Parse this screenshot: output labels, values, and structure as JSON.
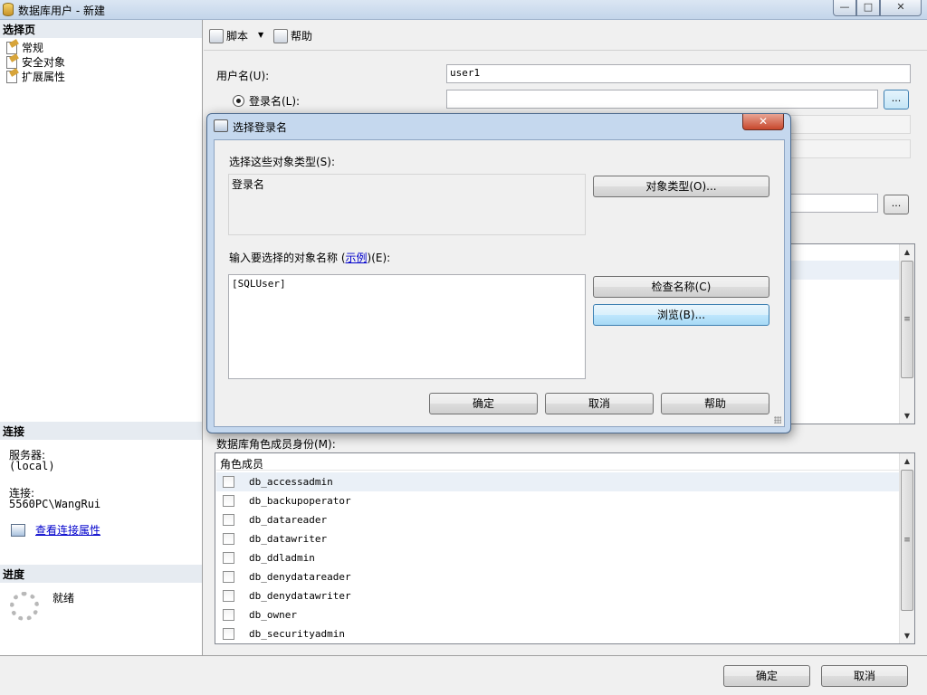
{
  "window": {
    "title": "数据库用户 - 新建",
    "minimize": "—",
    "maximize": "□",
    "close": "✕"
  },
  "left": {
    "select_page_header": "选择页",
    "pages": [
      "常规",
      "安全对象",
      "扩展属性"
    ],
    "connection_header": "连接",
    "server_label": "服务器:",
    "server_value": "(local)",
    "connection_label": "连接:",
    "connection_value": "5560PC\\WangRui",
    "view_conn_props": "查看连接属性",
    "progress_header": "进度",
    "progress_status": "就绪"
  },
  "toolbar": {
    "script": "脚本",
    "dropdown": "▼",
    "help": "帮助"
  },
  "form": {
    "username_label": "用户名(U):",
    "username_value": "user1",
    "login_label": "登录名(L):",
    "login_value": "",
    "browse_dots": "...",
    "role_membership_label": "数据库角色成员身份(M):",
    "role_header": "角色成员",
    "roles": [
      "db_accessadmin",
      "db_backupoperator",
      "db_datareader",
      "db_datawriter",
      "db_ddladmin",
      "db_denydatareader",
      "db_denydatawriter",
      "db_owner",
      "db_securityadmin"
    ]
  },
  "scroll": {
    "up": "▲",
    "down": "▼",
    "thumb": "≡"
  },
  "buttons": {
    "ok": "确定",
    "cancel": "取消"
  },
  "dialog": {
    "title": "选择登录名",
    "close": "✕",
    "object_types_label": "选择这些对象类型(S):",
    "object_types_value": "登录名",
    "object_types_button": "对象类型(O)...",
    "enter_names_label_pre": "输入要选择的对象名称 (",
    "enter_names_link": "示例",
    "enter_names_label_post": ")(E):",
    "names_value": "[SQLUser]",
    "check_names_button": "检查名称(C)",
    "browse_button": "浏览(B)...",
    "ok": "确定",
    "cancel": "取消",
    "help": "帮助"
  }
}
